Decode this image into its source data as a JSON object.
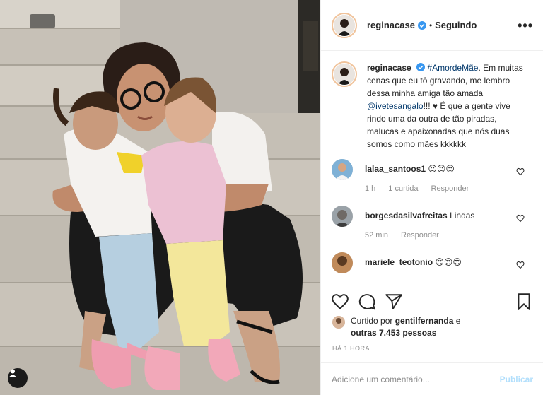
{
  "post": {
    "author": "reginacase",
    "follow_state": "Seguindo",
    "more_label": "•••",
    "tag_icon": "person-tag-icon"
  },
  "caption": {
    "username": "reginacase",
    "hashtag": "#AmordeMãe",
    "text_1": ". Em muitas cenas que eu tô gravando, me lembro dessa minha amiga tão amada ",
    "mention": "@ivetesangalo",
    "text_2": "!!! ♥ É que a gente vive rindo uma da outra de tão piradas, malucas e apaixonadas que nós duas somos como mães kkkkkk"
  },
  "comments": [
    {
      "username": "lalaa_santoos1",
      "text": "😍😍😍",
      "time": "1 h",
      "likes": "1 curtida",
      "reply": "Responder"
    },
    {
      "username": "borgesdasilvafreitas",
      "text": "Lindas",
      "time": "52 min",
      "reply": "Responder"
    },
    {
      "username": "mariele_teotonio",
      "text": "😍😍😍"
    }
  ],
  "likes": {
    "prefix": "Curtido por ",
    "user": "gentilfernanda",
    "joiner": " e",
    "others": "outras 7.453 pessoas"
  },
  "timestamp": "HÁ 1 HORA",
  "add_comment": {
    "placeholder": "Adicione um comentário...",
    "publish": "Publicar"
  },
  "colors": {
    "link": "#00376b",
    "verified": "#3897f0",
    "publish_disabled": "#b2dffc"
  }
}
